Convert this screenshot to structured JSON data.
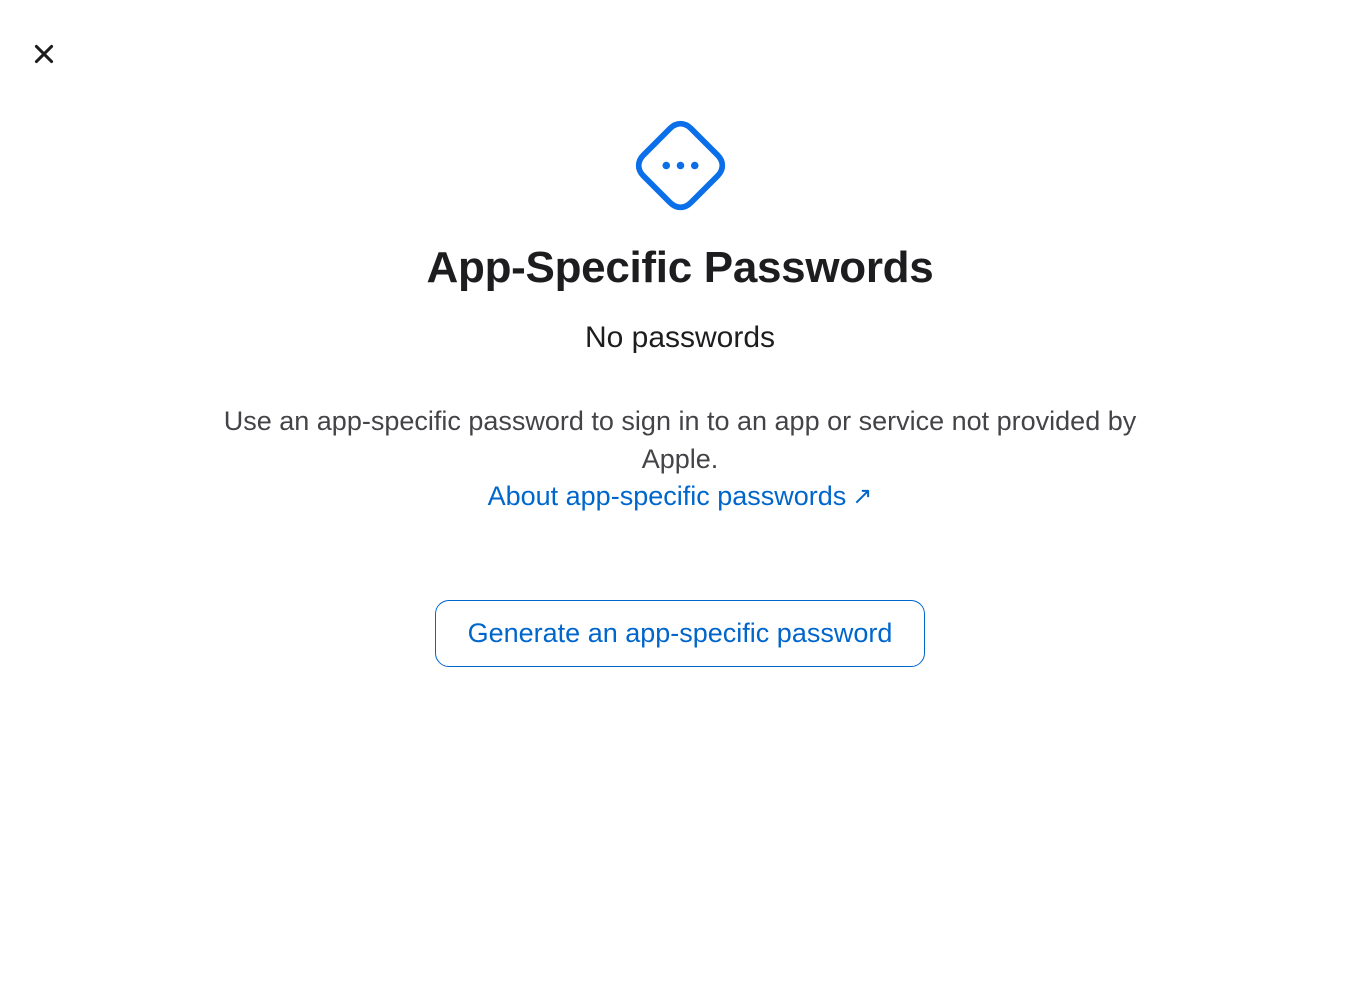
{
  "title": "App-Specific Passwords",
  "subtitle": "No passwords",
  "description": "Use an app-specific password to sign in to an app or service not provided by Apple.",
  "learnMoreLabel": "About app-specific passwords",
  "generateButtonLabel": "Generate an app-specific password",
  "colors": {
    "accent": "#0066cc",
    "text": "#1d1d1f",
    "secondaryText": "#444448"
  }
}
